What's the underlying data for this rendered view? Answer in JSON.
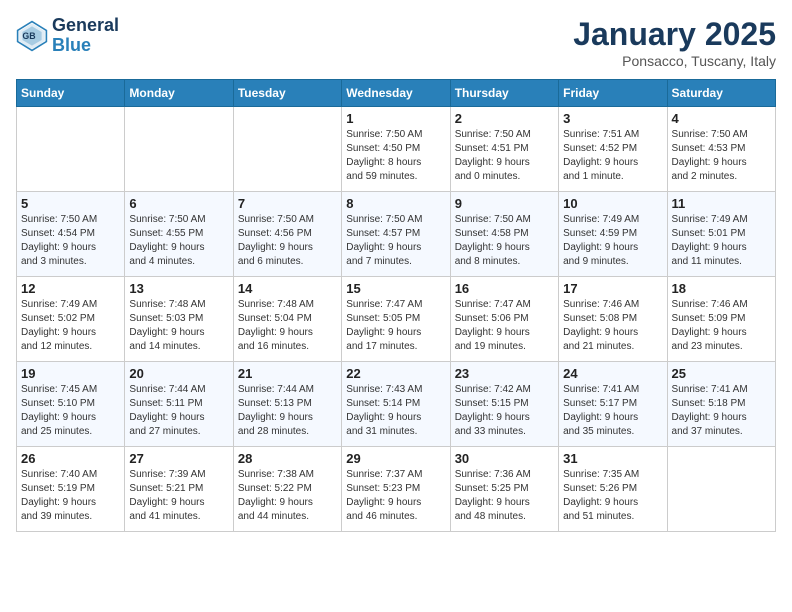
{
  "header": {
    "logo_line1": "General",
    "logo_line2": "Blue",
    "title": "January 2025",
    "subtitle": "Ponsacco, Tuscany, Italy"
  },
  "days_of_week": [
    "Sunday",
    "Monday",
    "Tuesday",
    "Wednesday",
    "Thursday",
    "Friday",
    "Saturday"
  ],
  "weeks": [
    [
      {
        "day": "",
        "info": ""
      },
      {
        "day": "",
        "info": ""
      },
      {
        "day": "",
        "info": ""
      },
      {
        "day": "1",
        "info": "Sunrise: 7:50 AM\nSunset: 4:50 PM\nDaylight: 8 hours\nand 59 minutes."
      },
      {
        "day": "2",
        "info": "Sunrise: 7:50 AM\nSunset: 4:51 PM\nDaylight: 9 hours\nand 0 minutes."
      },
      {
        "day": "3",
        "info": "Sunrise: 7:51 AM\nSunset: 4:52 PM\nDaylight: 9 hours\nand 1 minute."
      },
      {
        "day": "4",
        "info": "Sunrise: 7:50 AM\nSunset: 4:53 PM\nDaylight: 9 hours\nand 2 minutes."
      }
    ],
    [
      {
        "day": "5",
        "info": "Sunrise: 7:50 AM\nSunset: 4:54 PM\nDaylight: 9 hours\nand 3 minutes."
      },
      {
        "day": "6",
        "info": "Sunrise: 7:50 AM\nSunset: 4:55 PM\nDaylight: 9 hours\nand 4 minutes."
      },
      {
        "day": "7",
        "info": "Sunrise: 7:50 AM\nSunset: 4:56 PM\nDaylight: 9 hours\nand 6 minutes."
      },
      {
        "day": "8",
        "info": "Sunrise: 7:50 AM\nSunset: 4:57 PM\nDaylight: 9 hours\nand 7 minutes."
      },
      {
        "day": "9",
        "info": "Sunrise: 7:50 AM\nSunset: 4:58 PM\nDaylight: 9 hours\nand 8 minutes."
      },
      {
        "day": "10",
        "info": "Sunrise: 7:49 AM\nSunset: 4:59 PM\nDaylight: 9 hours\nand 9 minutes."
      },
      {
        "day": "11",
        "info": "Sunrise: 7:49 AM\nSunset: 5:01 PM\nDaylight: 9 hours\nand 11 minutes."
      }
    ],
    [
      {
        "day": "12",
        "info": "Sunrise: 7:49 AM\nSunset: 5:02 PM\nDaylight: 9 hours\nand 12 minutes."
      },
      {
        "day": "13",
        "info": "Sunrise: 7:48 AM\nSunset: 5:03 PM\nDaylight: 9 hours\nand 14 minutes."
      },
      {
        "day": "14",
        "info": "Sunrise: 7:48 AM\nSunset: 5:04 PM\nDaylight: 9 hours\nand 16 minutes."
      },
      {
        "day": "15",
        "info": "Sunrise: 7:47 AM\nSunset: 5:05 PM\nDaylight: 9 hours\nand 17 minutes."
      },
      {
        "day": "16",
        "info": "Sunrise: 7:47 AM\nSunset: 5:06 PM\nDaylight: 9 hours\nand 19 minutes."
      },
      {
        "day": "17",
        "info": "Sunrise: 7:46 AM\nSunset: 5:08 PM\nDaylight: 9 hours\nand 21 minutes."
      },
      {
        "day": "18",
        "info": "Sunrise: 7:46 AM\nSunset: 5:09 PM\nDaylight: 9 hours\nand 23 minutes."
      }
    ],
    [
      {
        "day": "19",
        "info": "Sunrise: 7:45 AM\nSunset: 5:10 PM\nDaylight: 9 hours\nand 25 minutes."
      },
      {
        "day": "20",
        "info": "Sunrise: 7:44 AM\nSunset: 5:11 PM\nDaylight: 9 hours\nand 27 minutes."
      },
      {
        "day": "21",
        "info": "Sunrise: 7:44 AM\nSunset: 5:13 PM\nDaylight: 9 hours\nand 28 minutes."
      },
      {
        "day": "22",
        "info": "Sunrise: 7:43 AM\nSunset: 5:14 PM\nDaylight: 9 hours\nand 31 minutes."
      },
      {
        "day": "23",
        "info": "Sunrise: 7:42 AM\nSunset: 5:15 PM\nDaylight: 9 hours\nand 33 minutes."
      },
      {
        "day": "24",
        "info": "Sunrise: 7:41 AM\nSunset: 5:17 PM\nDaylight: 9 hours\nand 35 minutes."
      },
      {
        "day": "25",
        "info": "Sunrise: 7:41 AM\nSunset: 5:18 PM\nDaylight: 9 hours\nand 37 minutes."
      }
    ],
    [
      {
        "day": "26",
        "info": "Sunrise: 7:40 AM\nSunset: 5:19 PM\nDaylight: 9 hours\nand 39 minutes."
      },
      {
        "day": "27",
        "info": "Sunrise: 7:39 AM\nSunset: 5:21 PM\nDaylight: 9 hours\nand 41 minutes."
      },
      {
        "day": "28",
        "info": "Sunrise: 7:38 AM\nSunset: 5:22 PM\nDaylight: 9 hours\nand 44 minutes."
      },
      {
        "day": "29",
        "info": "Sunrise: 7:37 AM\nSunset: 5:23 PM\nDaylight: 9 hours\nand 46 minutes."
      },
      {
        "day": "30",
        "info": "Sunrise: 7:36 AM\nSunset: 5:25 PM\nDaylight: 9 hours\nand 48 minutes."
      },
      {
        "day": "31",
        "info": "Sunrise: 7:35 AM\nSunset: 5:26 PM\nDaylight: 9 hours\nand 51 minutes."
      },
      {
        "day": "",
        "info": ""
      }
    ]
  ]
}
